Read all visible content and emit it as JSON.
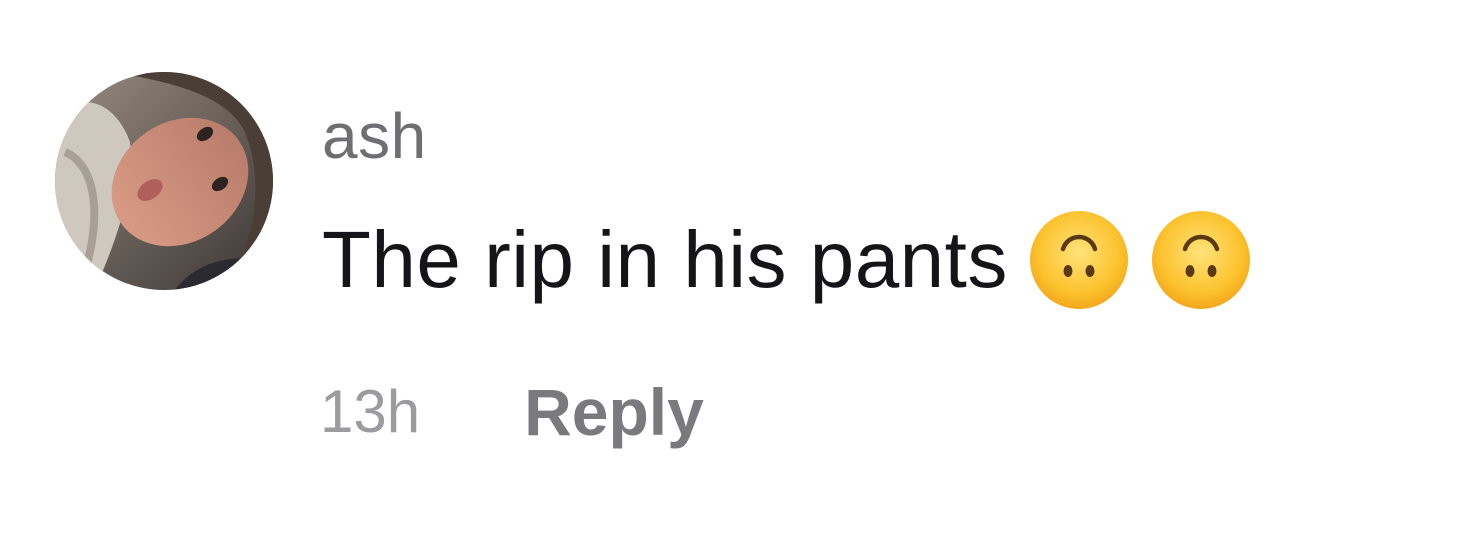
{
  "comment": {
    "username": "ash",
    "text": "The rip in his pants",
    "emojis": [
      "upside-down-face-icon",
      "upside-down-face-icon"
    ],
    "timestamp": "13h",
    "reply_label": "Reply"
  },
  "colors": {
    "username": "#6f6f73",
    "text": "#141419",
    "timestamp": "#9b9ba0",
    "reply": "#7a7a7e",
    "emoji_face": "#fbc02d"
  }
}
